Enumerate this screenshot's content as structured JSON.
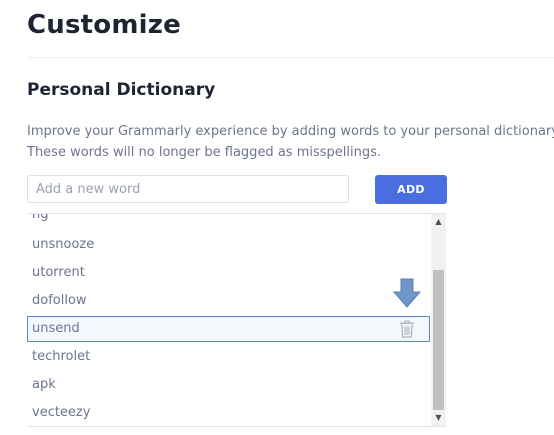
{
  "page": {
    "title": "Customize"
  },
  "personal_dictionary": {
    "title": "Personal Dictionary",
    "description_lines": [
      "Improve your Grammarly experience by adding words to your personal dictionary.",
      "These words will no longer be flagged as misspellings."
    ],
    "input": {
      "placeholder": "Add a new word",
      "value": ""
    },
    "add_label": "ADD",
    "words": [
      "ng",
      "unsnooze",
      "utorrent",
      "dofollow",
      "unsend",
      "techrolet",
      "apk",
      "vecteezy"
    ],
    "selected_word": "unsend"
  },
  "icons": {
    "trash": "trash-icon",
    "hint_arrow": "arrow-down-icon",
    "scroll_up": "scroll-up-arrow-icon",
    "scroll_down": "scroll-down-arrow-icon"
  },
  "colors": {
    "accent": "#4a6ee0",
    "selection_border": "#5f87c6",
    "hint_arrow": "#6f96c9",
    "text_muted": "#6d758d",
    "heading": "#1f2433"
  }
}
